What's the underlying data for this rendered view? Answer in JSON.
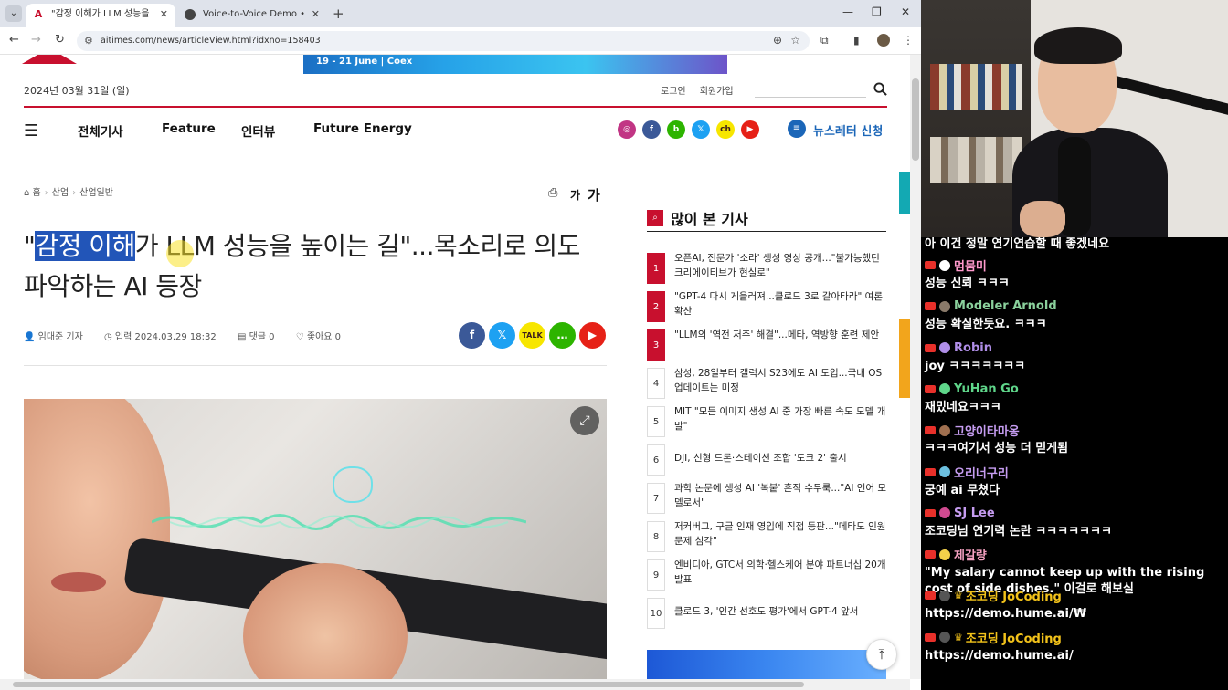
{
  "browser": {
    "tabs": [
      {
        "title": "\"감정 이해가 LLM 성능을 높이",
        "active": true
      },
      {
        "title": "Voice-to-Voice Demo • Hume",
        "active": false
      }
    ],
    "url": "aitimes.com/news/articleView.html?idxno=158403"
  },
  "site": {
    "banner_text": "19 - 21 June | Coex",
    "date": "2024년 03월 31일 (일)",
    "login": "로그인",
    "signup": "회원가입",
    "nav": [
      "전체기사",
      "Feature",
      "인터뷰",
      "Future Energy"
    ],
    "newsletter": "뉴스레터 신청"
  },
  "article": {
    "breadcrumb": [
      "홈",
      "산업",
      "산업일반"
    ],
    "font_small": "가",
    "font_large": "가",
    "title_highlight": "감정 이해",
    "title_rest": "가 LLM 성능을 높이는 길\"...목소리로 의도 파악하는 AI 등장",
    "title_quote": "\"",
    "author": "임대준 기자",
    "date": "입력 2024.03.29 18:32",
    "comments": "댓글 0",
    "likes": "좋아요 0"
  },
  "sidebar": {
    "title": "많이 본 기사",
    "items": [
      {
        "rank": "1",
        "text": "오픈AI, 전문가 '소라' 생성 영상 공개...\"불가능했던 크리에이티브가 현실로\""
      },
      {
        "rank": "2",
        "text": "\"GPT-4 다시 게을러져...클로드 3로 갈아타라\" 여론 확산"
      },
      {
        "rank": "3",
        "text": "\"LLM의 '역전 저주' 해결\"...메타, 역방향 훈련 제안"
      },
      {
        "rank": "4",
        "text": "삼성, 28일부터 갤럭시 S23에도 AI 도입...국내 OS 업데이트는 미정"
      },
      {
        "rank": "5",
        "text": "MIT \"모든 이미지 생성 AI 중 가장 빠른 속도 모델 개발\""
      },
      {
        "rank": "6",
        "text": "DJI, 신형 드론·스테이션 조합 '도크 2' 출시"
      },
      {
        "rank": "7",
        "text": "과학 논문에 생성 AI '복붙' 흔적 수두룩...\"AI 언어 모델로서\""
      },
      {
        "rank": "8",
        "text": "저커버그, 구글 인재 영입에 직접 등판...\"메타도 인원 문제 심각\""
      },
      {
        "rank": "9",
        "text": "엔비디아, GTC서 의학·헬스케어 분야 파트너십 20개 발표"
      },
      {
        "rank": "10",
        "text": "클로드 3, '인간 선호도 평가'에서 GPT-4 앞서"
      }
    ]
  },
  "chat": {
    "top_text": "아 이건 정말 연기연습할 때 좋겠네요",
    "messages": [
      {
        "user": "멈뭄미",
        "color": "#ff99cc",
        "text": "성능 신뢰 ㅋㅋㅋ"
      },
      {
        "user": "Modeler Arnold",
        "color": "#8ad19c",
        "text": "성능 확실한듯요. ㅋㅋㅋ"
      },
      {
        "user": "Robin",
        "color": "#b08ee8",
        "text": "joy ㅋㅋㅋㅋㅋㅋㅋ"
      },
      {
        "user": "YuHan Go",
        "color": "#5fd68a",
        "text": "재밌네요ㅋㅋㅋ"
      },
      {
        "user": "고양이타마옹",
        "color": "#c59cf0",
        "text": "ㅋㅋㅋ여기서 성능 더 믿게됨"
      },
      {
        "user": "오리너구리",
        "color": "#c59cf0",
        "text": "궁예 ai 무쳤다"
      },
      {
        "user": "SJ Lee",
        "color": "#c59cf0",
        "text": "조코딩님 연기력 논란 ㅋㅋㅋㅋㅋㅋㅋ"
      },
      {
        "user": "제갈량",
        "color": "#f4a0c0",
        "text": "\"My salary cannot keep up with the rising cost of side dishes.\" 이걸로 해보실"
      },
      {
        "user": "조코딩 JoCoding",
        "color": "#f2c21a",
        "text": "https://demo.hume.ai/₩"
      },
      {
        "user": "조코딩 JoCoding",
        "color": "#f2c21a",
        "text": "https://demo.hume.ai/"
      }
    ]
  }
}
